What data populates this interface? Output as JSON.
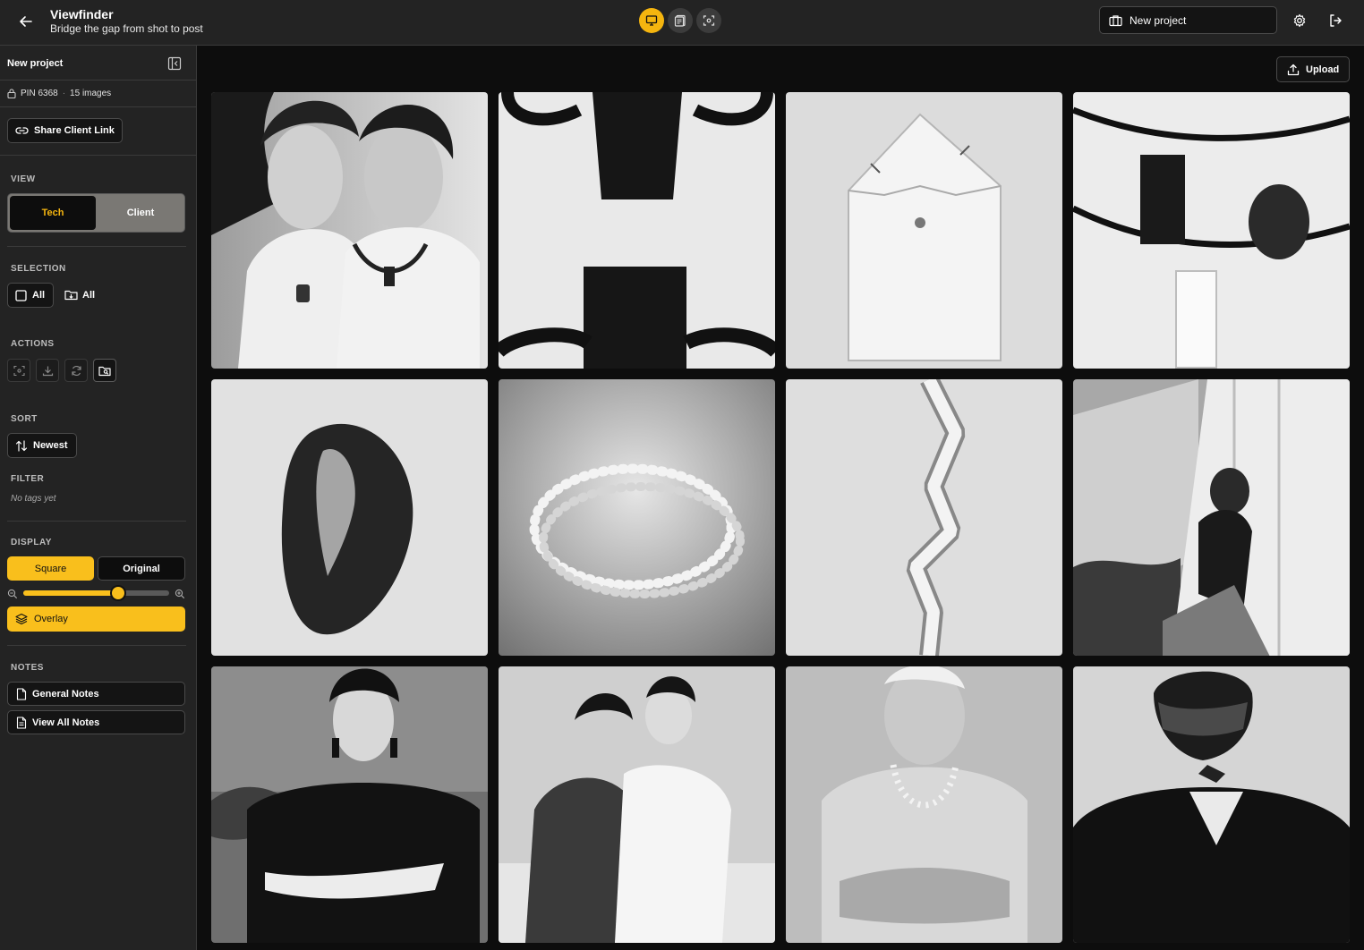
{
  "header": {
    "title": "Viewfinder",
    "subtitle": "Bridge the gap from shot to post",
    "project_selector": "New project",
    "modes": [
      "monitor-icon",
      "document-icon",
      "scan-icon"
    ],
    "accent": "#f9bf1c"
  },
  "sidebar": {
    "project_name": "New project",
    "pin": "PIN 6368",
    "separator": "·",
    "image_count": "15 images",
    "share_link": "Share Client Link",
    "view": {
      "label": "VIEW",
      "tech": "Tech",
      "client": "Client",
      "selected": "Tech"
    },
    "selection": {
      "label": "SELECTION",
      "select_all": "All",
      "download_all": "All"
    },
    "actions": {
      "label": "ACTIONS",
      "icons": [
        "scan-icon",
        "download-icon",
        "refresh-icon",
        "folder-search-icon"
      ]
    },
    "sort": {
      "label": "SORT",
      "value": "Newest"
    },
    "filter": {
      "label": "FILTER",
      "empty": "No tags yet"
    },
    "display": {
      "label": "DISPLAY",
      "square": "Square",
      "original": "Original",
      "zoom_level": 0.65,
      "overlay": "Overlay",
      "selected": "Square"
    },
    "notes": {
      "label": "NOTES",
      "general": "General Notes",
      "view_all": "View All Notes"
    }
  },
  "main": {
    "upload_label": "Upload",
    "images": [
      {
        "subject": "two-women-portrait"
      },
      {
        "subject": "black-ring-clasp"
      },
      {
        "subject": "crystal-pendant"
      },
      {
        "subject": "cord-with-pendants"
      },
      {
        "subject": "baroque-pearl"
      },
      {
        "subject": "pearl-necklace"
      },
      {
        "subject": "crystal-chain"
      },
      {
        "subject": "couple-on-balcony"
      },
      {
        "subject": "woman-arms-crossed"
      },
      {
        "subject": "two-women-seated"
      },
      {
        "subject": "older-man-portrait"
      },
      {
        "subject": "hands-over-face"
      }
    ]
  }
}
